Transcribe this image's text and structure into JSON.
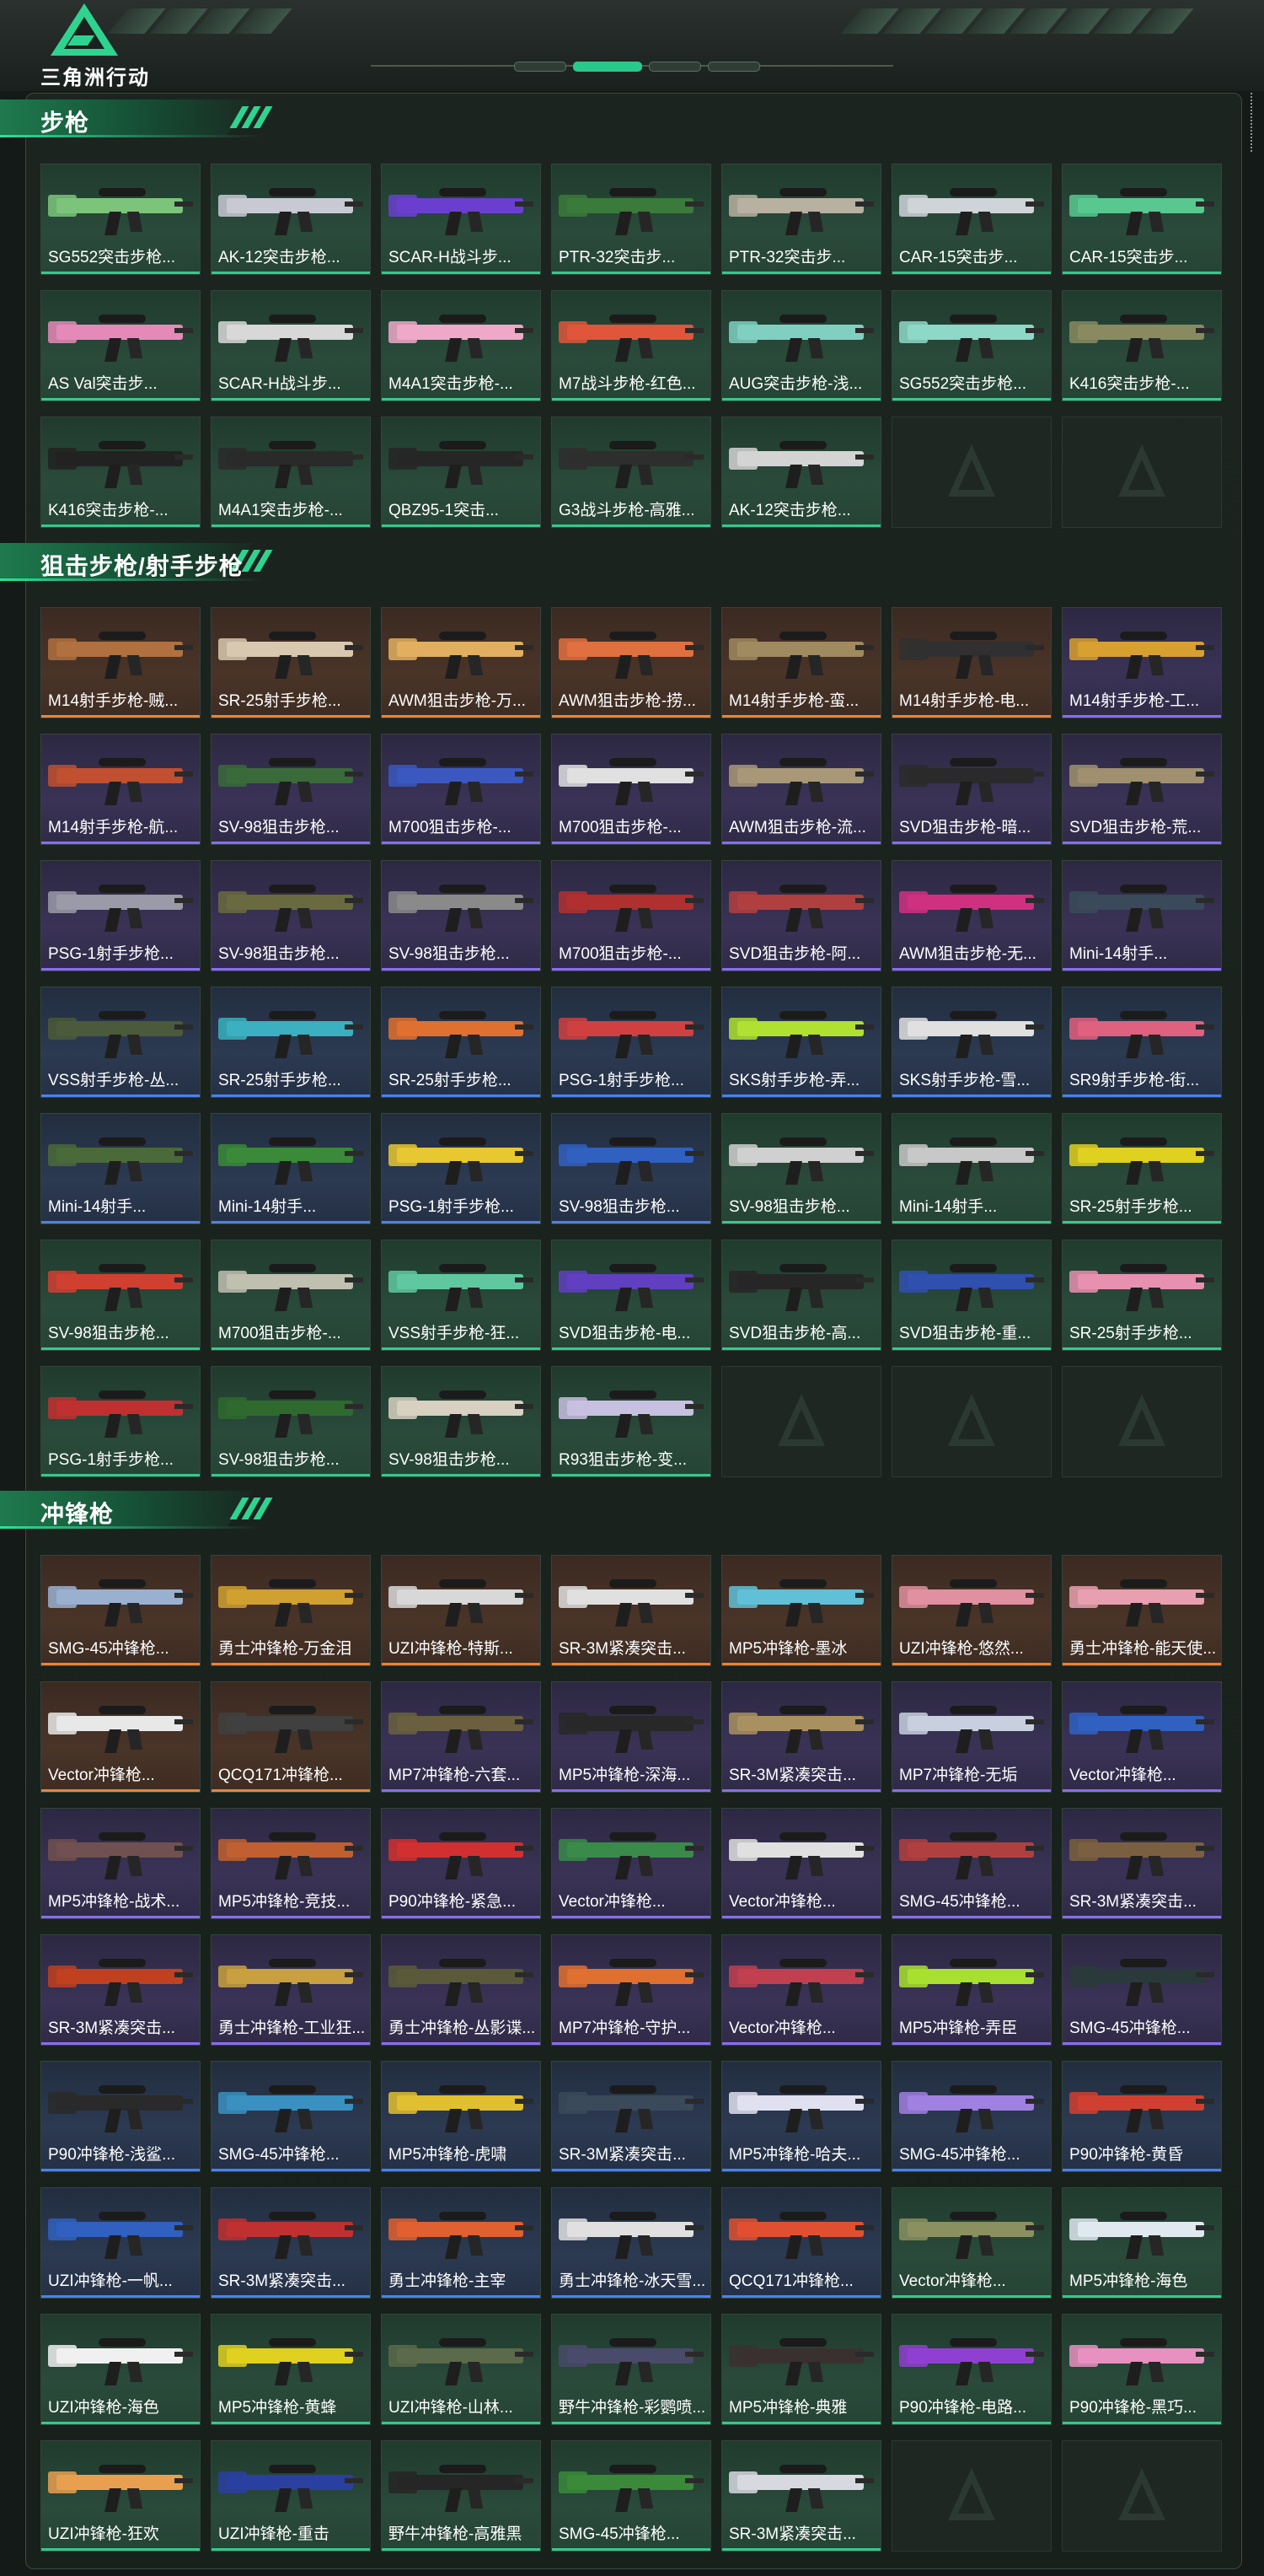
{
  "header": {
    "logo_text": "三角洲行动"
  },
  "colors": {
    "accent": "#2fe29a",
    "rarity_green": "#34c98c",
    "rarity_orange": "#e8843a",
    "rarity_purple": "#8a6cf0",
    "rarity_blue": "#4a82e8"
  },
  "sections": [
    {
      "title": "步枪",
      "items": [
        {
          "name": "SG552突击步枪...",
          "rarity": "green",
          "color": "#7cc47a"
        },
        {
          "name": "AK-12突击步枪...",
          "rarity": "green",
          "color": "#c9c9d4"
        },
        {
          "name": "SCAR-H战斗步...",
          "rarity": "green",
          "color": "#6a3fd0"
        },
        {
          "name": "PTR-32突击步...",
          "rarity": "green",
          "color": "#3a7a3a"
        },
        {
          "name": "PTR-32突击步...",
          "rarity": "green",
          "color": "#b8b0a0"
        },
        {
          "name": "CAR-15突击步...",
          "rarity": "green",
          "color": "#cfd4d8"
        },
        {
          "name": "CAR-15突击步...",
          "rarity": "green",
          "color": "#58c890"
        },
        {
          "name": "AS Val突击步...",
          "rarity": "green",
          "color": "#e58ab8"
        },
        {
          "name": "SCAR-H战斗步...",
          "rarity": "green",
          "color": "#d8d8d8"
        },
        {
          "name": "M4A1突击步枪-...",
          "rarity": "green",
          "color": "#f0a8c8"
        },
        {
          "name": "M7战斗步枪-红色...",
          "rarity": "green",
          "color": "#e0563a"
        },
        {
          "name": "AUG突击步枪-浅...",
          "rarity": "green",
          "color": "#7fd0c0"
        },
        {
          "name": "SG552突击步枪...",
          "rarity": "green",
          "color": "#8ed8c8"
        },
        {
          "name": "K416突击步枪-...",
          "rarity": "green",
          "color": "#8a8a60"
        },
        {
          "name": "K416突击步枪-...",
          "rarity": "green",
          "color": "#222222"
        },
        {
          "name": "M4A1突击步枪-...",
          "rarity": "green",
          "color": "#2a2a2a"
        },
        {
          "name": "QBZ95-1突击...",
          "rarity": "green",
          "color": "#262626"
        },
        {
          "name": "G3战斗步枪-高雅...",
          "rarity": "green",
          "color": "#2e2e2e"
        },
        {
          "name": "AK-12突击步枪...",
          "rarity": "green",
          "color": "#d4d4d4"
        }
      ],
      "empty_slots": 2
    },
    {
      "title": "狙击步枪/射手步枪",
      "items": [
        {
          "name": "M14射手步枪-贼...",
          "rarity": "orange",
          "color": "#b07040"
        },
        {
          "name": "SR-25射手步枪...",
          "rarity": "orange",
          "color": "#d8c8b0"
        },
        {
          "name": "AWM狙击步枪-万...",
          "rarity": "orange",
          "color": "#e0b060"
        },
        {
          "name": "AWM狙击步枪-捞...",
          "rarity": "orange",
          "color": "#e07040"
        },
        {
          "name": "M14射手步枪-蛮...",
          "rarity": "orange",
          "color": "#a08a60"
        },
        {
          "name": "M14射手步枪-电...",
          "rarity": "orange",
          "color": "#303030"
        },
        {
          "name": "M14射手步枪-工...",
          "rarity": "purple",
          "color": "#d8a030"
        },
        {
          "name": "M14射手步枪-航...",
          "rarity": "purple",
          "color": "#c05030"
        },
        {
          "name": "SV-98狙击步枪...",
          "rarity": "purple",
          "color": "#3a6a3a"
        },
        {
          "name": "M700狙击步枪-...",
          "rarity": "purple",
          "color": "#3a58c0"
        },
        {
          "name": "M700狙击步枪-...",
          "rarity": "purple",
          "color": "#e0e0e0"
        },
        {
          "name": "AWM狙击步枪-流...",
          "rarity": "purple",
          "color": "#a89878"
        },
        {
          "name": "SVD狙击步枪-暗...",
          "rarity": "purple",
          "color": "#2a2a2a"
        },
        {
          "name": "SVD狙击步枪-荒...",
          "rarity": "purple",
          "color": "#a09070"
        },
        {
          "name": "PSG-1射手步枪...",
          "rarity": "purple",
          "color": "#9a9aa8"
        },
        {
          "name": "SV-98狙击步枪...",
          "rarity": "purple",
          "color": "#6a6a40"
        },
        {
          "name": "SV-98狙击步枪...",
          "rarity": "purple",
          "color": "#8a8a8a"
        },
        {
          "name": "M700狙击步枪-...",
          "rarity": "purple",
          "color": "#b03030"
        },
        {
          "name": "SVD狙击步枪-阿...",
          "rarity": "purple",
          "color": "#b04040"
        },
        {
          "name": "AWM狙击步枪-无...",
          "rarity": "purple",
          "color": "#d03080"
        },
        {
          "name": "Mini-14射手...",
          "rarity": "purple",
          "color": "#3a4a5a"
        },
        {
          "name": "VSS射手步枪-丛...",
          "rarity": "blue",
          "color": "#4a5a3a"
        },
        {
          "name": "SR-25射手步枪...",
          "rarity": "blue",
          "color": "#3ab0c0"
        },
        {
          "name": "SR-25射手步枪...",
          "rarity": "blue",
          "color": "#e07030"
        },
        {
          "name": "PSG-1射手步枪...",
          "rarity": "blue",
          "color": "#d04040"
        },
        {
          "name": "SKS射手步枪-弄...",
          "rarity": "blue",
          "color": "#b0e030"
        },
        {
          "name": "SKS射手步枪-雪...",
          "rarity": "blue",
          "color": "#e0e0e0"
        },
        {
          "name": "SR9射手步枪-街...",
          "rarity": "blue",
          "color": "#e06080"
        },
        {
          "name": "Mini-14射手...",
          "rarity": "blue",
          "color": "#4a6a3a"
        },
        {
          "name": "Mini-14射手...",
          "rarity": "blue",
          "color": "#3a8a3a"
        },
        {
          "name": "PSG-1射手步枪...",
          "rarity": "blue",
          "color": "#e8c830"
        },
        {
          "name": "SV-98狙击步枪...",
          "rarity": "blue",
          "color": "#3060c0"
        },
        {
          "name": "SV-98狙击步枪...",
          "rarity": "green",
          "color": "#d0d0d0"
        },
        {
          "name": "Mini-14射手...",
          "rarity": "green",
          "color": "#c8c8c8"
        },
        {
          "name": "SR-25射手步枪...",
          "rarity": "green",
          "color": "#e0d020"
        },
        {
          "name": "SV-98狙击步枪...",
          "rarity": "green",
          "color": "#d04030"
        },
        {
          "name": "M700狙击步枪-...",
          "rarity": "green",
          "color": "#c0c0b0"
        },
        {
          "name": "VSS射手步枪-狂...",
          "rarity": "green",
          "color": "#60c8a0"
        },
        {
          "name": "SVD狙击步枪-电...",
          "rarity": "green",
          "color": "#6040c0"
        },
        {
          "name": "SVD狙击步枪-高...",
          "rarity": "green",
          "color": "#262626"
        },
        {
          "name": "SVD狙击步枪-重...",
          "rarity": "green",
          "color": "#3050b0"
        },
        {
          "name": "SR-25射手步枪...",
          "rarity": "green",
          "color": "#e890b0"
        },
        {
          "name": "PSG-1射手步枪...",
          "rarity": "green",
          "color": "#c03030"
        },
        {
          "name": "SV-98狙击步枪...",
          "rarity": "green",
          "color": "#2e6a2e"
        },
        {
          "name": "SV-98狙击步枪...",
          "rarity": "green",
          "color": "#d8d0c0"
        },
        {
          "name": "R93狙击步枪-变...",
          "rarity": "green",
          "color": "#c8c0e0"
        }
      ],
      "empty_slots": 3
    },
    {
      "title": "冲锋枪",
      "items": [
        {
          "name": "SMG-45冲锋枪...",
          "rarity": "orange",
          "color": "#9ab0d0"
        },
        {
          "name": "勇士冲锋枪-万金泪",
          "rarity": "orange",
          "color": "#d0a030"
        },
        {
          "name": "UZI冲锋枪-特斯...",
          "rarity": "orange",
          "color": "#d8d8d8"
        },
        {
          "name": "SR-3M紧凑突击...",
          "rarity": "orange",
          "color": "#e0e0e0"
        },
        {
          "name": "MP5冲锋枪-墨冰",
          "rarity": "orange",
          "color": "#60c0d8"
        },
        {
          "name": "UZI冲锋枪-悠然...",
          "rarity": "orange",
          "color": "#e090a0"
        },
        {
          "name": "勇士冲锋枪-能天使...",
          "rarity": "orange",
          "color": "#e8a0b0"
        },
        {
          "name": "Vector冲锋枪...",
          "rarity": "orange",
          "color": "#e8e8e8"
        },
        {
          "name": "QCQ171冲锋枪...",
          "rarity": "orange",
          "color": "#404040"
        },
        {
          "name": "MP7冲锋枪-六套...",
          "rarity": "purple",
          "color": "#6a6040"
        },
        {
          "name": "MP5冲锋枪-深海...",
          "rarity": "purple",
          "color": "#282828"
        },
        {
          "name": "SR-3M紧凑突击...",
          "rarity": "purple",
          "color": "#a89060"
        },
        {
          "name": "MP7冲锋枪-无垢",
          "rarity": "purple",
          "color": "#c8d0e0"
        },
        {
          "name": "Vector冲锋枪...",
          "rarity": "purple",
          "color": "#3060c0"
        },
        {
          "name": "MP5冲锋枪-战术...",
          "rarity": "purple",
          "color": "#705050"
        },
        {
          "name": "MP5冲锋枪-竞技...",
          "rarity": "purple",
          "color": "#c06030"
        },
        {
          "name": "P90冲锋枪-紧急...",
          "rarity": "purple",
          "color": "#d03030"
        },
        {
          "name": "Vector冲锋枪...",
          "rarity": "purple",
          "color": "#3a8a4a"
        },
        {
          "name": "Vector冲锋枪...",
          "rarity": "purple",
          "color": "#e0e0e0"
        },
        {
          "name": "SMG-45冲锋枪...",
          "rarity": "purple",
          "color": "#b04040"
        },
        {
          "name": "SR-3M紧凑突击...",
          "rarity": "purple",
          "color": "#7a6040"
        },
        {
          "name": "SR-3M紧凑突击...",
          "rarity": "purple",
          "color": "#c04020"
        },
        {
          "name": "勇士冲锋枪-工业狂...",
          "rarity": "purple",
          "color": "#c8a040"
        },
        {
          "name": "勇士冲锋枪-丛影谍...",
          "rarity": "purple",
          "color": "#5a5a3a"
        },
        {
          "name": "MP7冲锋枪-守护...",
          "rarity": "purple",
          "color": "#e07030"
        },
        {
          "name": "Vector冲锋枪...",
          "rarity": "purple",
          "color": "#c04050"
        },
        {
          "name": "MP5冲锋枪-弄臣",
          "rarity": "purple",
          "color": "#a8e030"
        },
        {
          "name": "SMG-45冲锋枪...",
          "rarity": "purple",
          "color": "#2a3a3a"
        },
        {
          "name": "P90冲锋枪-浅鲨...",
          "rarity": "blue",
          "color": "#2a2a2a"
        },
        {
          "name": "SMG-45冲锋枪...",
          "rarity": "blue",
          "color": "#3a90c0"
        },
        {
          "name": "MP5冲锋枪-虎啸",
          "rarity": "blue",
          "color": "#e0c030"
        },
        {
          "name": "SR-3M紧凑突击...",
          "rarity": "blue",
          "color": "#3a4a5a"
        },
        {
          "name": "MP5冲锋枪-哈夫...",
          "rarity": "blue",
          "color": "#e0e0f0"
        },
        {
          "name": "SMG-45冲锋枪...",
          "rarity": "blue",
          "color": "#a080e0"
        },
        {
          "name": "P90冲锋枪-黄昏",
          "rarity": "blue",
          "color": "#d04030"
        },
        {
          "name": "UZI冲锋枪-一帆...",
          "rarity": "blue",
          "color": "#3060c0"
        },
        {
          "name": "SR-3M紧凑突击...",
          "rarity": "blue",
          "color": "#c03030"
        },
        {
          "name": "勇士冲锋枪-主宰",
          "rarity": "blue",
          "color": "#e06030"
        },
        {
          "name": "勇士冲锋枪-冰天雪...",
          "rarity": "blue",
          "color": "#e0e0e0"
        },
        {
          "name": "QCQ171冲锋枪...",
          "rarity": "blue",
          "color": "#e05030"
        },
        {
          "name": "Vector冲锋枪...",
          "rarity": "green",
          "color": "#8a9060"
        },
        {
          "name": "MP5冲锋枪-海色",
          "rarity": "green",
          "color": "#e0e8f0"
        },
        {
          "name": "UZI冲锋枪-海色",
          "rarity": "green",
          "color": "#f0f0f0"
        },
        {
          "name": "MP5冲锋枪-黄蜂",
          "rarity": "green",
          "color": "#e0d020"
        },
        {
          "name": "UZI冲锋枪-山林...",
          "rarity": "green",
          "color": "#5a6a4a"
        },
        {
          "name": "野牛冲锋枪-彩鹦喷...",
          "rarity": "green",
          "color": "#4a4a6a"
        },
        {
          "name": "MP5冲锋枪-典雅",
          "rarity": "green",
          "color": "#3a3030"
        },
        {
          "name": "P90冲锋枪-电路...",
          "rarity": "green",
          "color": "#9040d0"
        },
        {
          "name": "P90冲锋枪-黑巧...",
          "rarity": "green",
          "color": "#e890c0"
        },
        {
          "name": "UZI冲锋枪-狂欢",
          "rarity": "green",
          "color": "#e8a050"
        },
        {
          "name": "UZI冲锋枪-重击",
          "rarity": "green",
          "color": "#2a40a0"
        },
        {
          "name": "野牛冲锋枪-高雅黑",
          "rarity": "green",
          "color": "#262626"
        },
        {
          "name": "SMG-45冲锋枪...",
          "rarity": "green",
          "color": "#3a8a3a"
        },
        {
          "name": "SR-3M紧凑突击...",
          "rarity": "green",
          "color": "#d8d8e0"
        }
      ],
      "empty_slots": 2
    }
  ]
}
